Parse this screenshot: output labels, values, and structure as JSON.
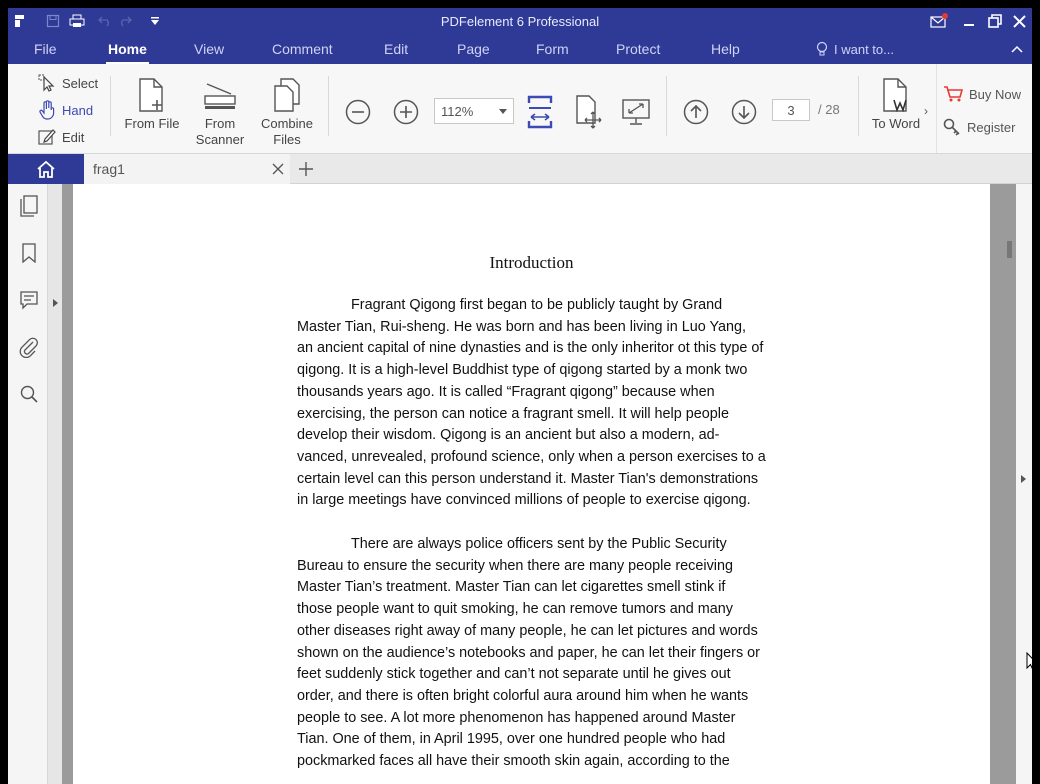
{
  "app": {
    "title": "PDFelement 6 Professional"
  },
  "menu": {
    "items": [
      "File",
      "Home",
      "View",
      "Comment",
      "Edit",
      "Page",
      "Form",
      "Protect",
      "Help"
    ],
    "active": "Home",
    "i_want_to": "I want to..."
  },
  "ribbon": {
    "modes": {
      "select": "Select",
      "hand": "Hand",
      "edit": "Edit"
    },
    "from_file": "From File",
    "from_scanner_1": "From",
    "from_scanner_2": "Scanner",
    "combine_1": "Combine",
    "combine_2": "Files",
    "zoom": "112%",
    "current_page": "3",
    "total_pages": "/ 28",
    "to_word": "To Word",
    "buy_now": "Buy Now",
    "register": "Register"
  },
  "tabs": {
    "doc": "frag1"
  },
  "document": {
    "heading": "Introduction",
    "para1": [
      "Fragrant Qigong first began to be publicly taught by Grand",
      "Master Tian, Rui-sheng.  He was born and has been living in Luo Yang,",
      "an ancient capital of nine dynasties and is the only inheritor ot this type of",
      "qigong.  It is a high-level Buddhist type of qigong started by a monk two",
      "thousands years ago.  It is called “Fragrant qigong” because when",
      "exercising, the person can notice a fragrant smell.  It will help people",
      "develop their wisdom.  Qigong is an ancient but also a modern, ad-",
      "vanced, unrevealed, profound science, only when a person exercises to a",
      "certain level can this person understand it.  Master Tian's demonstrations",
      "in large meetings have convinced millions of people to exercise qigong."
    ],
    "para2": [
      "There are always police officers sent by the Public Security",
      "Bureau to ensure the security when there are many people receiving",
      "Master Tian’s treatment.  Master Tian can let cigarettes smell stink if",
      "those people want to quit smoking, he can remove tumors and many",
      "other diseases right away of many people, he can let pictures and words",
      "shown on the audience’s notebooks and paper, he can let their fingers or",
      "feet suddenly stick together and can’t not separate until he gives out",
      "order, and there is often bright colorful aura around him when he wants",
      "people to see. A lot more phenomenon has happened around Master",
      "Tian.  One of them, in April 1995, over one hundred people who had",
      "pockmarked faces all have their smooth skin again, according to the"
    ]
  },
  "colors": {
    "titlebar": "#2f3a96",
    "accent": "#3b4ab4",
    "buy_cart": "#e53935"
  }
}
